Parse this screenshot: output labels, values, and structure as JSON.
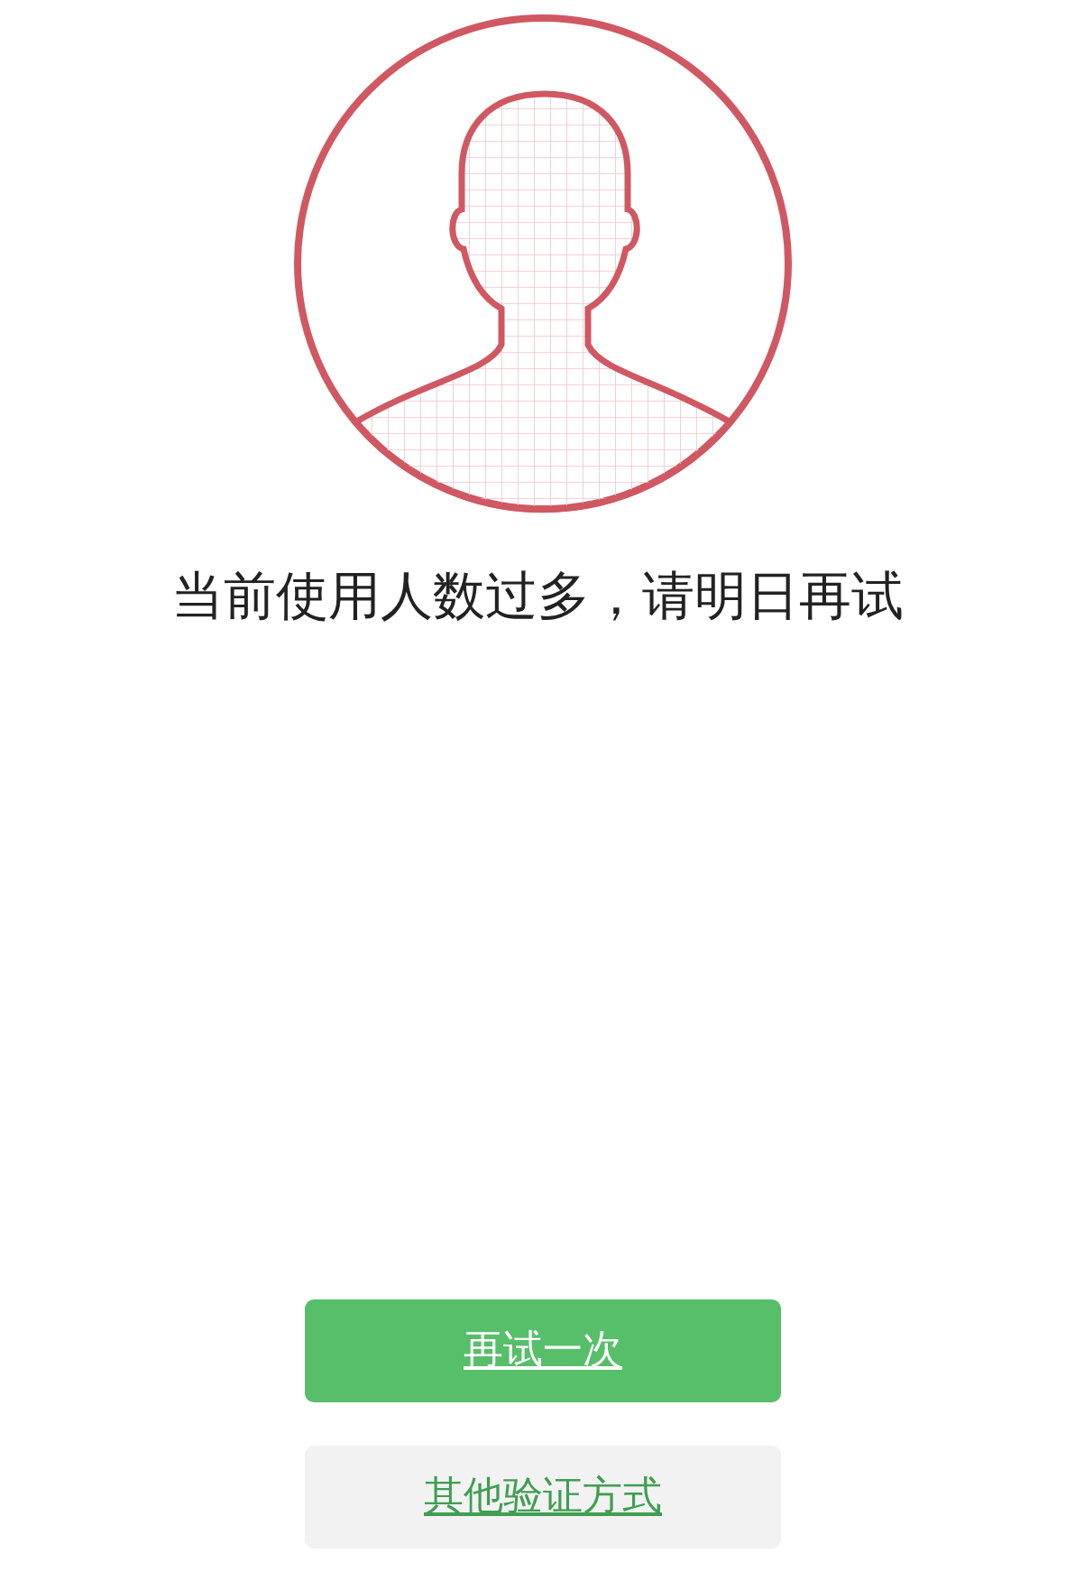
{
  "message": "当前使用人数过多，请明日再试",
  "buttons": [
    {
      "label": "再试一次",
      "kind": "primary"
    },
    {
      "label": "其他验证方式",
      "kind": "secondary"
    }
  ]
}
